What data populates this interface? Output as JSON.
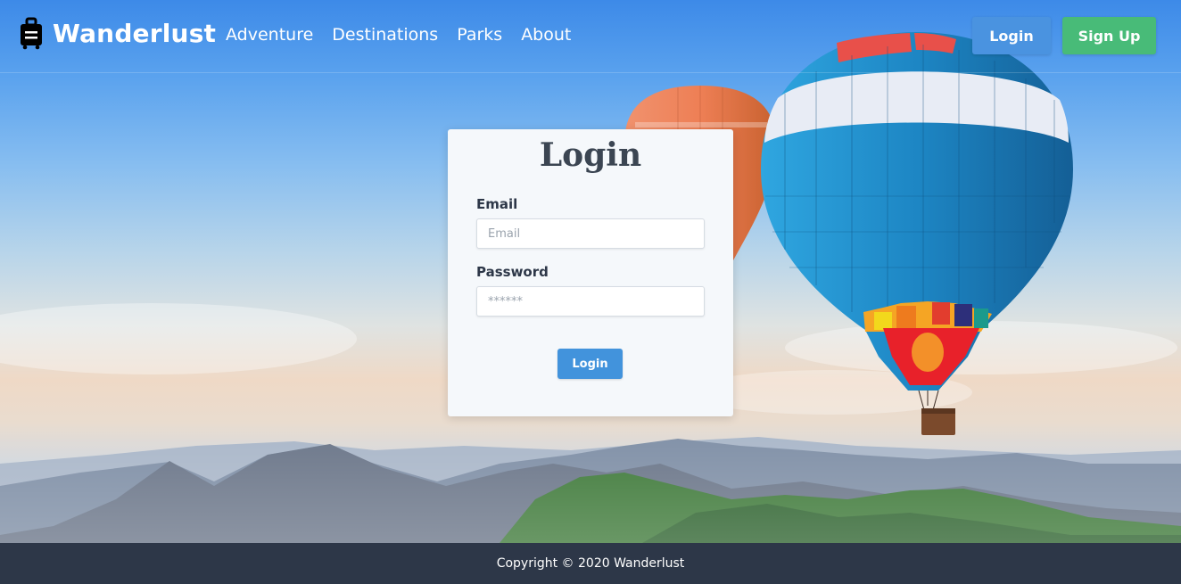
{
  "brand": {
    "name": "Wanderlust",
    "icon": "suitcase-icon"
  },
  "nav": {
    "links": [
      "Adventure",
      "Destinations",
      "Parks",
      "About"
    ]
  },
  "header_buttons": {
    "login": "Login",
    "signup": "Sign Up"
  },
  "login_form": {
    "title": "Login",
    "email_label": "Email",
    "email_placeholder": "Email",
    "email_value": "",
    "password_label": "Password",
    "password_placeholder": "******",
    "password_value": "",
    "submit_label": "Login"
  },
  "footer": {
    "text": "Copyright © 2020 Wanderlust"
  },
  "colors": {
    "login_button": "#4a93e0",
    "signup_button": "#48bb78",
    "footer_bg": "#2d3748",
    "card_bg": "#f5f8fb"
  }
}
